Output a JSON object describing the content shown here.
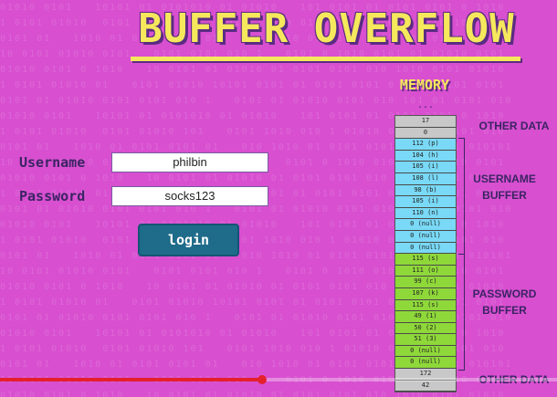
{
  "title": "BUFFER OVERFLOW",
  "form": {
    "username_label": "Username",
    "username_value": "philbin",
    "password_label": "Password",
    "password_value": "socks123",
    "login_label": "login"
  },
  "memory": {
    "title": "MEMORY",
    "ellipsis": "...",
    "cells": [
      {
        "text": "17",
        "kind": "other"
      },
      {
        "text": "0",
        "kind": "other"
      },
      {
        "text": "112 (p)",
        "kind": "user"
      },
      {
        "text": "104 (h)",
        "kind": "user"
      },
      {
        "text": "105 (i)",
        "kind": "user"
      },
      {
        "text": "108 (l)",
        "kind": "user"
      },
      {
        "text": "98 (b)",
        "kind": "user"
      },
      {
        "text": "105 (i)",
        "kind": "user"
      },
      {
        "text": "110 (n)",
        "kind": "user"
      },
      {
        "text": "0 (null)",
        "kind": "user"
      },
      {
        "text": "0 (null)",
        "kind": "user"
      },
      {
        "text": "0 (null)",
        "kind": "user"
      },
      {
        "text": "115 (s)",
        "kind": "pass"
      },
      {
        "text": "111 (o)",
        "kind": "pass"
      },
      {
        "text": "99 (c)",
        "kind": "pass"
      },
      {
        "text": "107 (k)",
        "kind": "pass"
      },
      {
        "text": "115 (s)",
        "kind": "pass"
      },
      {
        "text": "49 (1)",
        "kind": "pass"
      },
      {
        "text": "50 (2)",
        "kind": "pass"
      },
      {
        "text": "51 (3)",
        "kind": "pass"
      },
      {
        "text": "0 (null)",
        "kind": "pass"
      },
      {
        "text": "0 (null)",
        "kind": "pass"
      },
      {
        "text": "172",
        "kind": "other"
      },
      {
        "text": "42",
        "kind": "other"
      }
    ],
    "labels": {
      "other_top": "OTHER DATA",
      "username_buffer_1": "USERNAME",
      "username_buffer_2": "BUFFER",
      "password_buffer_1": "PASSWORD",
      "password_buffer_2": "BUFFER",
      "other_bottom": "OTHER DATA"
    }
  },
  "video": {
    "progress_fraction": 0.47
  },
  "colors": {
    "background": "#d84fd0",
    "title": "#f6e85c",
    "username_cell": "#79d9f6",
    "password_cell": "#8fd83a",
    "other_cell": "#c8c8c8",
    "login_button": "#1f6b8a",
    "progress": "#e4202d"
  }
}
